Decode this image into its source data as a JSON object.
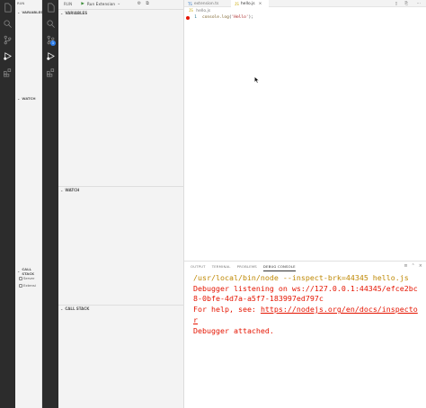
{
  "background_window": {
    "run_label": "RUN",
    "sections": {
      "variables": "VARIABLES",
      "watch": "WATCH",
      "call_stack": "CALL STACK"
    },
    "call_stack_items": [
      "Server",
      "Extensi"
    ]
  },
  "sidebar": {
    "title": "RUN",
    "run_config": "Run Extension",
    "sections": {
      "variables": "VARIABLES",
      "watch": "WATCH",
      "call_stack": "CALL STACK"
    },
    "badge_count": "1"
  },
  "editor": {
    "tabs": [
      {
        "label": "extension.ts",
        "icon": "TS"
      },
      {
        "label": "hello.js",
        "icon": "JS"
      }
    ],
    "breadcrumb": "hello.js",
    "lines": [
      {
        "number": "1",
        "fn": "console.log",
        "args_open": "(",
        "string": "'Hello'",
        "args_close": ");"
      }
    ]
  },
  "panel": {
    "tabs": [
      "OUTPUT",
      "TERMINAL",
      "PROBLEMS",
      "DEBUG CONSOLE"
    ],
    "active_tab": "DEBUG CONSOLE",
    "console": {
      "command": "/usr/local/bin/node --inspect-brk=44345 hello.js",
      "line2": "Debugger listening on ws://127.0.0.1:44345/efce2bc",
      "line3": "8-0bfe-4d7a-a5f7-183997ed797c",
      "help_prefix": "For help, see: ",
      "help_link": "https://nodejs.org/en/docs/inspecto",
      "help_link_wrap": "r",
      "attached": "Debugger attached."
    }
  },
  "colors": {
    "activity_bar": "#2c2c2c",
    "sidebar": "#f3f3f3",
    "breakpoint": "#e51400",
    "console_error": "#e51400",
    "console_warn": "#bf8803",
    "run_green": "#388a34"
  }
}
